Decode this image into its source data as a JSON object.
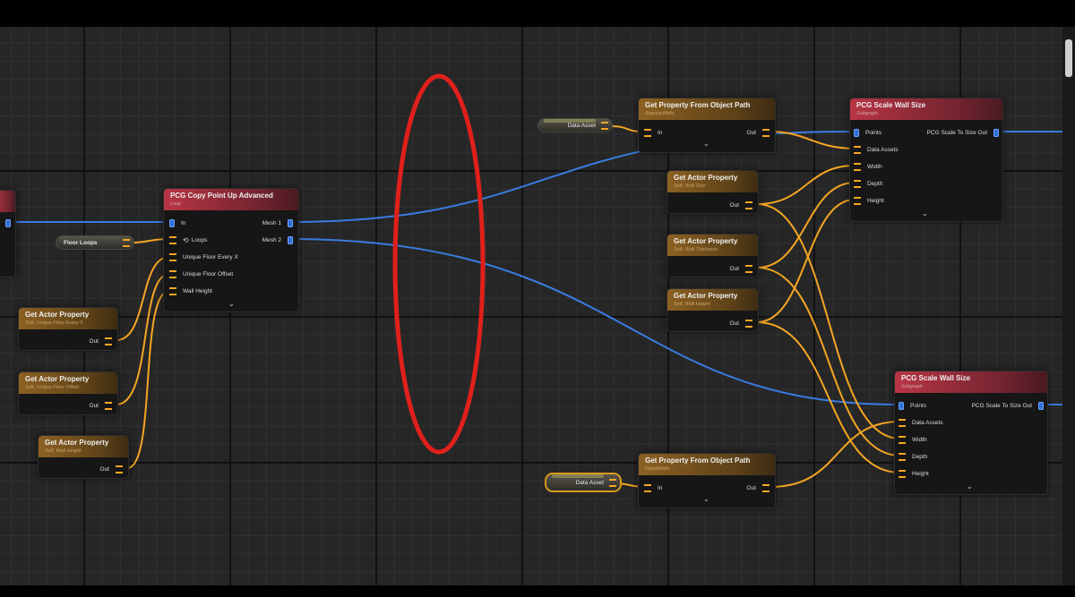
{
  "graph": {
    "nodes": {
      "copy_point": {
        "title": "PCG Copy Point Up Advanced",
        "subtitle": "Loop",
        "pins": {
          "in": "In",
          "loops": "Loops",
          "unique_every": "Unique Floor Every X",
          "unique_offset": "Unique Floor Offset",
          "wall_height": "Wall Height",
          "mesh1": "Mesh 1",
          "mesh2": "Mesh 2"
        }
      },
      "actor_prop_every": {
        "title": "Get Actor Property",
        "subtitle": "Self, Unique Floor Every X",
        "out": "Out"
      },
      "actor_prop_offset": {
        "title": "Get Actor Property",
        "subtitle": "Self, Unique Floor Offset",
        "out": "Out"
      },
      "actor_prop_height_left": {
        "title": "Get Actor Property",
        "subtitle": "Self, Wall Height",
        "out": "Out"
      },
      "path_top": {
        "title": "Get Property From Object Path",
        "subtitle": "RegularWalls",
        "in": "In",
        "out": "Out"
      },
      "path_bottom": {
        "title": "Get Property From Object Path",
        "subtitle": "DetailWalls",
        "in": "In",
        "out": "Out"
      },
      "actor_prop_size": {
        "title": "Get Actor Property",
        "subtitle": "Self, Wall Size",
        "out": "Out"
      },
      "actor_prop_thickness": {
        "title": "Get Actor Property",
        "subtitle": "Self, Wall Thickness",
        "out": "Out"
      },
      "actor_prop_height_right": {
        "title": "Get Actor Property",
        "subtitle": "Self, Wall Height",
        "out": "Out"
      },
      "scale_top": {
        "title": "PCG Scale Wall Size",
        "subtitle": "Subgraph",
        "pins": {
          "points": "Points",
          "data_assets": "Data Assets",
          "width": "Width",
          "depth": "Depth",
          "height": "Height",
          "out": "PCG Scale To Size Out"
        }
      },
      "scale_bottom": {
        "title": "PCG Scale Wall Size",
        "subtitle": "Subgraph",
        "pins": {
          "points": "Points",
          "data_assets": "Data Assets",
          "width": "Width",
          "depth": "Depth",
          "height": "Height",
          "out": "PCG Scale To Size Out"
        }
      }
    },
    "variables": {
      "floor_loops": "Floor Loops",
      "data_asset_top": "Data Asset",
      "data_asset_bottom": "Data Asset"
    }
  },
  "colors": {
    "canvas": "#262626",
    "data_wire": "#f5a623",
    "points_wire": "#3a7be0",
    "highlight_ellipse": "#e0201c",
    "subgraph_header": "#b83544",
    "getter_header": "#8c6122"
  }
}
